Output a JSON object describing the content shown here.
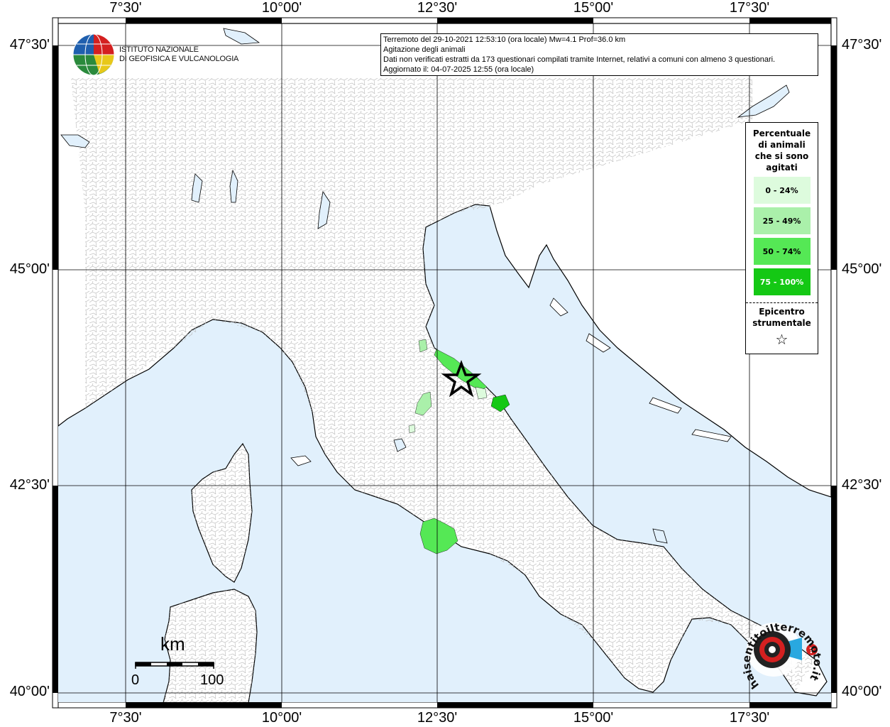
{
  "map": {
    "info": {
      "line1": "Terremoto del 29-10-2021 12:53:10 (ora locale) Mw=4.1 Prof=36.0 km",
      "line2": "Agitazione degli animali",
      "line3": "Dati non verificati estratti da 173 questionari compilati tramite Internet, relativi a comuni con almeno 3 questionari.",
      "line4": "Aggiornato il: 04-07-2025 12:55 (ora locale)"
    },
    "lon_ticks": [
      "7°30'",
      "10°00'",
      "12°30'",
      "15°00'",
      "17°30'"
    ],
    "lat_ticks": [
      "47°30'",
      "45°00'",
      "42°30'",
      "40°00'"
    ],
    "logo": {
      "line1": "ISTITUTO NAZIONALE",
      "line2": "DI GEOFISICA E VULCANOLOGIA",
      "icon": "ingv-globe-logo"
    },
    "legend": {
      "title": "Percentuale di animali che si sono agitati",
      "items": [
        {
          "label": "0 - 24%",
          "color": "#ddfbdd"
        },
        {
          "label": "25 - 49%",
          "color": "#aaf0aa"
        },
        {
          "label": "50 - 74%",
          "color": "#55e855"
        },
        {
          "label": "75 - 100%",
          "color": "#14c814"
        }
      ],
      "epicenter_label": "Epicentro strumentale",
      "epicenter_icon": "star-icon"
    },
    "scale": {
      "unit": "km",
      "start": "0",
      "end": "100"
    },
    "hsit_logo": {
      "text": "haisentitoilterremoto.it",
      "icon": "hsit-logo"
    },
    "colors": {
      "sea": "#e1f0fc",
      "land": "#ffffff",
      "border": "#000000"
    }
  }
}
